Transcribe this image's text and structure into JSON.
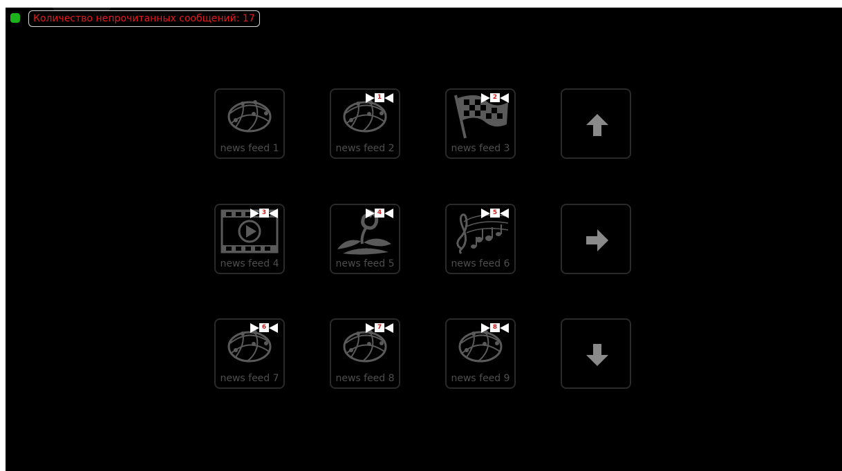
{
  "header": {
    "unread_text": "Количество непрочитанных сообщений: 17",
    "status_color": "#1db31d",
    "text_color": "#e8191c"
  },
  "tiles": [
    {
      "label": "news feed 1",
      "icon": "globe-icon",
      "badge": ""
    },
    {
      "label": "news feed 2",
      "icon": "globe-icon",
      "badge": "1"
    },
    {
      "label": "news feed 3",
      "icon": "checkered-flag-icon",
      "badge": "2"
    },
    {
      "label": "news feed 4",
      "icon": "film-play-icon",
      "badge": "3"
    },
    {
      "label": "news feed 5",
      "icon": "flower-icon",
      "badge": "4"
    },
    {
      "label": "news feed 6",
      "icon": "music-notes-icon",
      "badge": "5"
    },
    {
      "label": "news feed 7",
      "icon": "globe-icon",
      "badge": "6"
    },
    {
      "label": "news feed 8",
      "icon": "globe-icon",
      "badge": "7"
    },
    {
      "label": "news feed 9",
      "icon": "globe-icon",
      "badge": "8"
    }
  ],
  "nav": [
    {
      "icon": "arrow-up-icon"
    },
    {
      "icon": "arrow-right-icon"
    },
    {
      "icon": "arrow-down-icon"
    }
  ],
  "colors": {
    "tile_border": "#2a2a2a",
    "icon_gray": "#5a5a5a",
    "nav_arrow": "#8a8a8a",
    "badge_text": "#d31c1c"
  }
}
